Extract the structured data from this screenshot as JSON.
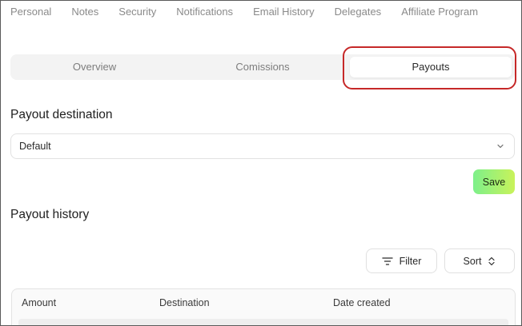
{
  "top_nav": {
    "items": [
      {
        "label": "Personal"
      },
      {
        "label": "Notes"
      },
      {
        "label": "Security"
      },
      {
        "label": "Notifications"
      },
      {
        "label": "Email History"
      },
      {
        "label": "Delegates"
      },
      {
        "label": "Affiliate Program"
      }
    ]
  },
  "tabs": {
    "items": [
      {
        "label": "Overview"
      },
      {
        "label": "Comissions"
      },
      {
        "label": "Payouts"
      }
    ],
    "active": "Payouts"
  },
  "payout_destination": {
    "title": "Payout destination",
    "selected": "Default",
    "save_label": "Save"
  },
  "payout_history": {
    "title": "Payout history",
    "filter_label": "Filter",
    "sort_label": "Sort",
    "columns": [
      "Amount",
      "Destination",
      "Date created"
    ]
  },
  "colors": {
    "highlight": "#c62828",
    "save_gradient_start": "#7df08a",
    "save_gradient_end": "#c9f25a"
  },
  "icons": {
    "select": "chevron-down-icon",
    "filter": "filter-lines-icon",
    "sort": "chevron-up-down-icon"
  }
}
